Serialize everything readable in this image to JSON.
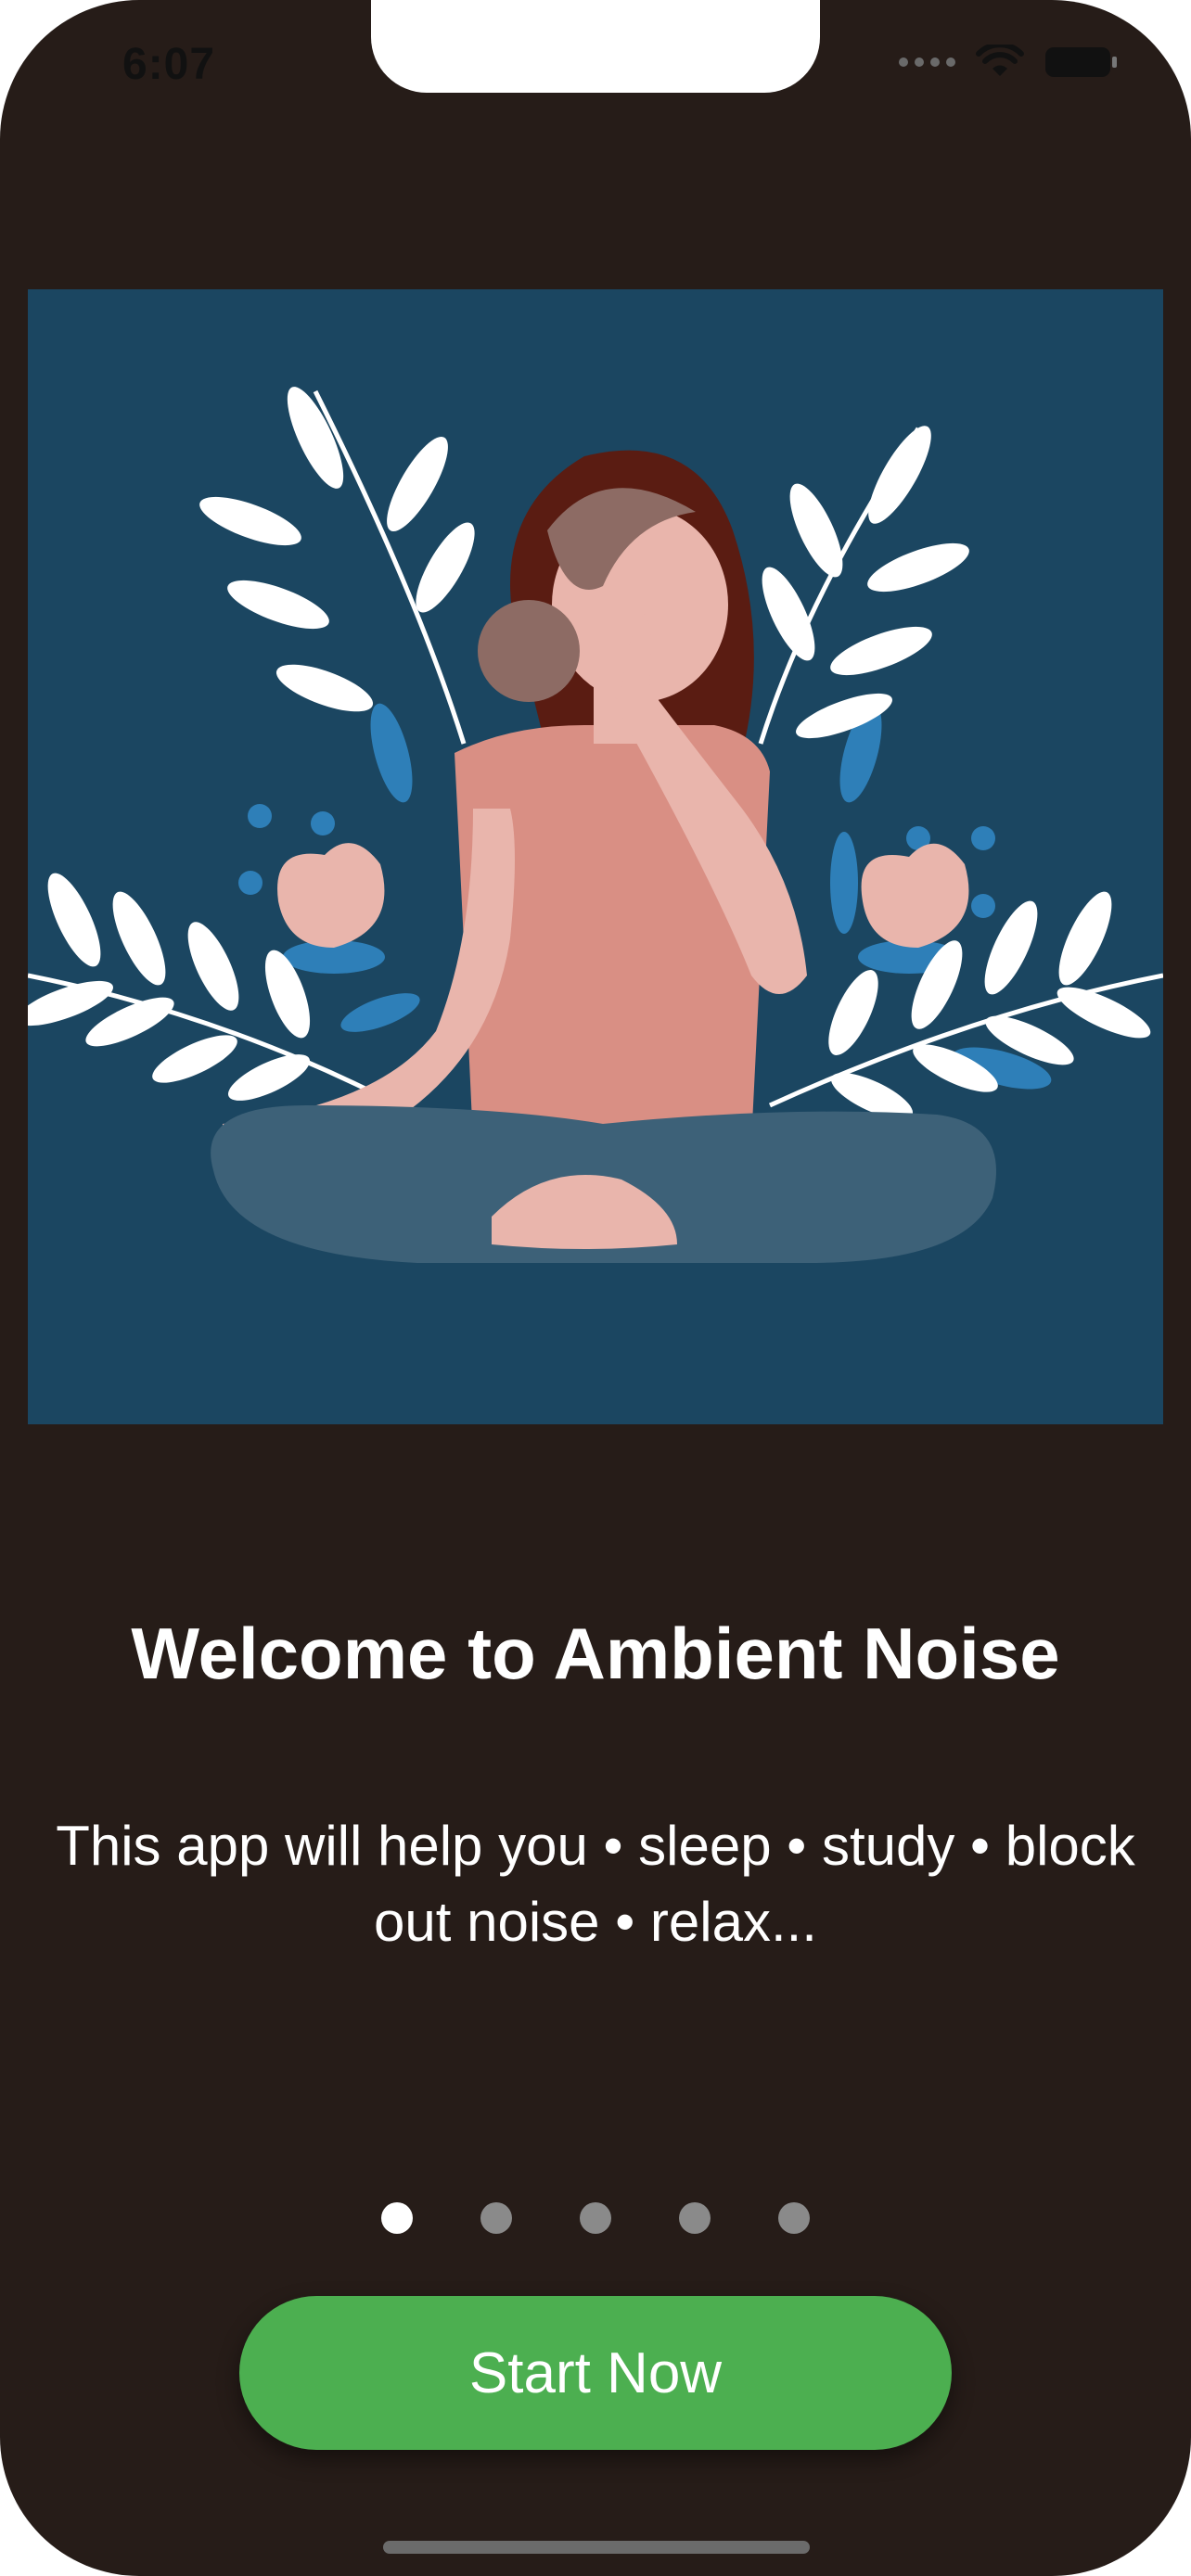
{
  "status_bar": {
    "time": "6:07"
  },
  "hero": {
    "icon": "meditation-illustration"
  },
  "onboarding": {
    "title": "Welcome to Ambient Noise",
    "subtitle": "This app will help you • sleep • study • block out noise  • relax...",
    "page_count": 5,
    "current_page": 1
  },
  "actions": {
    "start_label": "Start Now"
  },
  "colors": {
    "background": "#261c18",
    "hero_background": "#1b4661",
    "accent": "#4caf50",
    "text": "#ffffff",
    "dot_inactive": "#8a8a8a",
    "dot_active": "#ffffff"
  }
}
